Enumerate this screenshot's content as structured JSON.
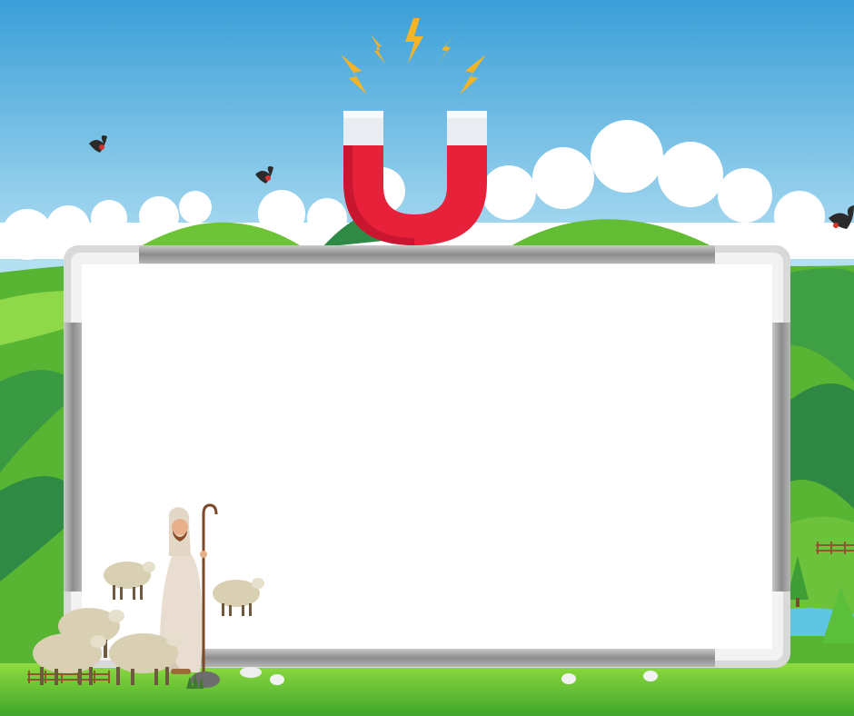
{
  "scene": {
    "subject": "whiteboard-with-shepherd-and-sheep",
    "colors": {
      "sky_top": "#3a9fd8",
      "sky_bottom": "#bfe6f5",
      "hill_light": "#7ccf3a",
      "hill_mid": "#4fae3c",
      "hill_dark": "#2f8a45",
      "grass": "#56bb2d",
      "board_face": "#ffffff",
      "board_frame": "#a7a7a7",
      "board_corner": "#d9d9d9",
      "magnet_red": "#e8213a",
      "magnet_tip": "#e9edf1",
      "spark": "#f5b326",
      "sheep_wool": "#d9cfb2",
      "robe": "#e8ddd0"
    },
    "icons": [
      "magnet-icon",
      "spark-icon",
      "bird-icon",
      "sheep-icon",
      "shepherd-icon",
      "tree-icon",
      "fence-icon"
    ]
  }
}
